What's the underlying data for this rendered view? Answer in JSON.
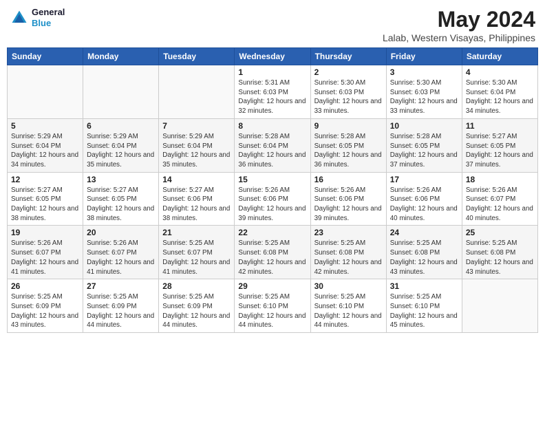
{
  "header": {
    "logo_line1": "General",
    "logo_line2": "Blue",
    "title": "May 2024",
    "subtitle": "Lalab, Western Visayas, Philippines"
  },
  "weekdays": [
    "Sunday",
    "Monday",
    "Tuesday",
    "Wednesday",
    "Thursday",
    "Friday",
    "Saturday"
  ],
  "weeks": [
    [
      {
        "day": "",
        "info": ""
      },
      {
        "day": "",
        "info": ""
      },
      {
        "day": "",
        "info": ""
      },
      {
        "day": "1",
        "info": "Sunrise: 5:31 AM\nSunset: 6:03 PM\nDaylight: 12 hours and 32 minutes."
      },
      {
        "day": "2",
        "info": "Sunrise: 5:30 AM\nSunset: 6:03 PM\nDaylight: 12 hours and 33 minutes."
      },
      {
        "day": "3",
        "info": "Sunrise: 5:30 AM\nSunset: 6:03 PM\nDaylight: 12 hours and 33 minutes."
      },
      {
        "day": "4",
        "info": "Sunrise: 5:30 AM\nSunset: 6:04 PM\nDaylight: 12 hours and 34 minutes."
      }
    ],
    [
      {
        "day": "5",
        "info": "Sunrise: 5:29 AM\nSunset: 6:04 PM\nDaylight: 12 hours and 34 minutes."
      },
      {
        "day": "6",
        "info": "Sunrise: 5:29 AM\nSunset: 6:04 PM\nDaylight: 12 hours and 35 minutes."
      },
      {
        "day": "7",
        "info": "Sunrise: 5:29 AM\nSunset: 6:04 PM\nDaylight: 12 hours and 35 minutes."
      },
      {
        "day": "8",
        "info": "Sunrise: 5:28 AM\nSunset: 6:04 PM\nDaylight: 12 hours and 36 minutes."
      },
      {
        "day": "9",
        "info": "Sunrise: 5:28 AM\nSunset: 6:05 PM\nDaylight: 12 hours and 36 minutes."
      },
      {
        "day": "10",
        "info": "Sunrise: 5:28 AM\nSunset: 6:05 PM\nDaylight: 12 hours and 37 minutes."
      },
      {
        "day": "11",
        "info": "Sunrise: 5:27 AM\nSunset: 6:05 PM\nDaylight: 12 hours and 37 minutes."
      }
    ],
    [
      {
        "day": "12",
        "info": "Sunrise: 5:27 AM\nSunset: 6:05 PM\nDaylight: 12 hours and 38 minutes."
      },
      {
        "day": "13",
        "info": "Sunrise: 5:27 AM\nSunset: 6:05 PM\nDaylight: 12 hours and 38 minutes."
      },
      {
        "day": "14",
        "info": "Sunrise: 5:27 AM\nSunset: 6:06 PM\nDaylight: 12 hours and 38 minutes."
      },
      {
        "day": "15",
        "info": "Sunrise: 5:26 AM\nSunset: 6:06 PM\nDaylight: 12 hours and 39 minutes."
      },
      {
        "day": "16",
        "info": "Sunrise: 5:26 AM\nSunset: 6:06 PM\nDaylight: 12 hours and 39 minutes."
      },
      {
        "day": "17",
        "info": "Sunrise: 5:26 AM\nSunset: 6:06 PM\nDaylight: 12 hours and 40 minutes."
      },
      {
        "day": "18",
        "info": "Sunrise: 5:26 AM\nSunset: 6:07 PM\nDaylight: 12 hours and 40 minutes."
      }
    ],
    [
      {
        "day": "19",
        "info": "Sunrise: 5:26 AM\nSunset: 6:07 PM\nDaylight: 12 hours and 41 minutes."
      },
      {
        "day": "20",
        "info": "Sunrise: 5:26 AM\nSunset: 6:07 PM\nDaylight: 12 hours and 41 minutes."
      },
      {
        "day": "21",
        "info": "Sunrise: 5:25 AM\nSunset: 6:07 PM\nDaylight: 12 hours and 41 minutes."
      },
      {
        "day": "22",
        "info": "Sunrise: 5:25 AM\nSunset: 6:08 PM\nDaylight: 12 hours and 42 minutes."
      },
      {
        "day": "23",
        "info": "Sunrise: 5:25 AM\nSunset: 6:08 PM\nDaylight: 12 hours and 42 minutes."
      },
      {
        "day": "24",
        "info": "Sunrise: 5:25 AM\nSunset: 6:08 PM\nDaylight: 12 hours and 43 minutes."
      },
      {
        "day": "25",
        "info": "Sunrise: 5:25 AM\nSunset: 6:08 PM\nDaylight: 12 hours and 43 minutes."
      }
    ],
    [
      {
        "day": "26",
        "info": "Sunrise: 5:25 AM\nSunset: 6:09 PM\nDaylight: 12 hours and 43 minutes."
      },
      {
        "day": "27",
        "info": "Sunrise: 5:25 AM\nSunset: 6:09 PM\nDaylight: 12 hours and 44 minutes."
      },
      {
        "day": "28",
        "info": "Sunrise: 5:25 AM\nSunset: 6:09 PM\nDaylight: 12 hours and 44 minutes."
      },
      {
        "day": "29",
        "info": "Sunrise: 5:25 AM\nSunset: 6:10 PM\nDaylight: 12 hours and 44 minutes."
      },
      {
        "day": "30",
        "info": "Sunrise: 5:25 AM\nSunset: 6:10 PM\nDaylight: 12 hours and 44 minutes."
      },
      {
        "day": "31",
        "info": "Sunrise: 5:25 AM\nSunset: 6:10 PM\nDaylight: 12 hours and 45 minutes."
      },
      {
        "day": "",
        "info": ""
      }
    ]
  ]
}
